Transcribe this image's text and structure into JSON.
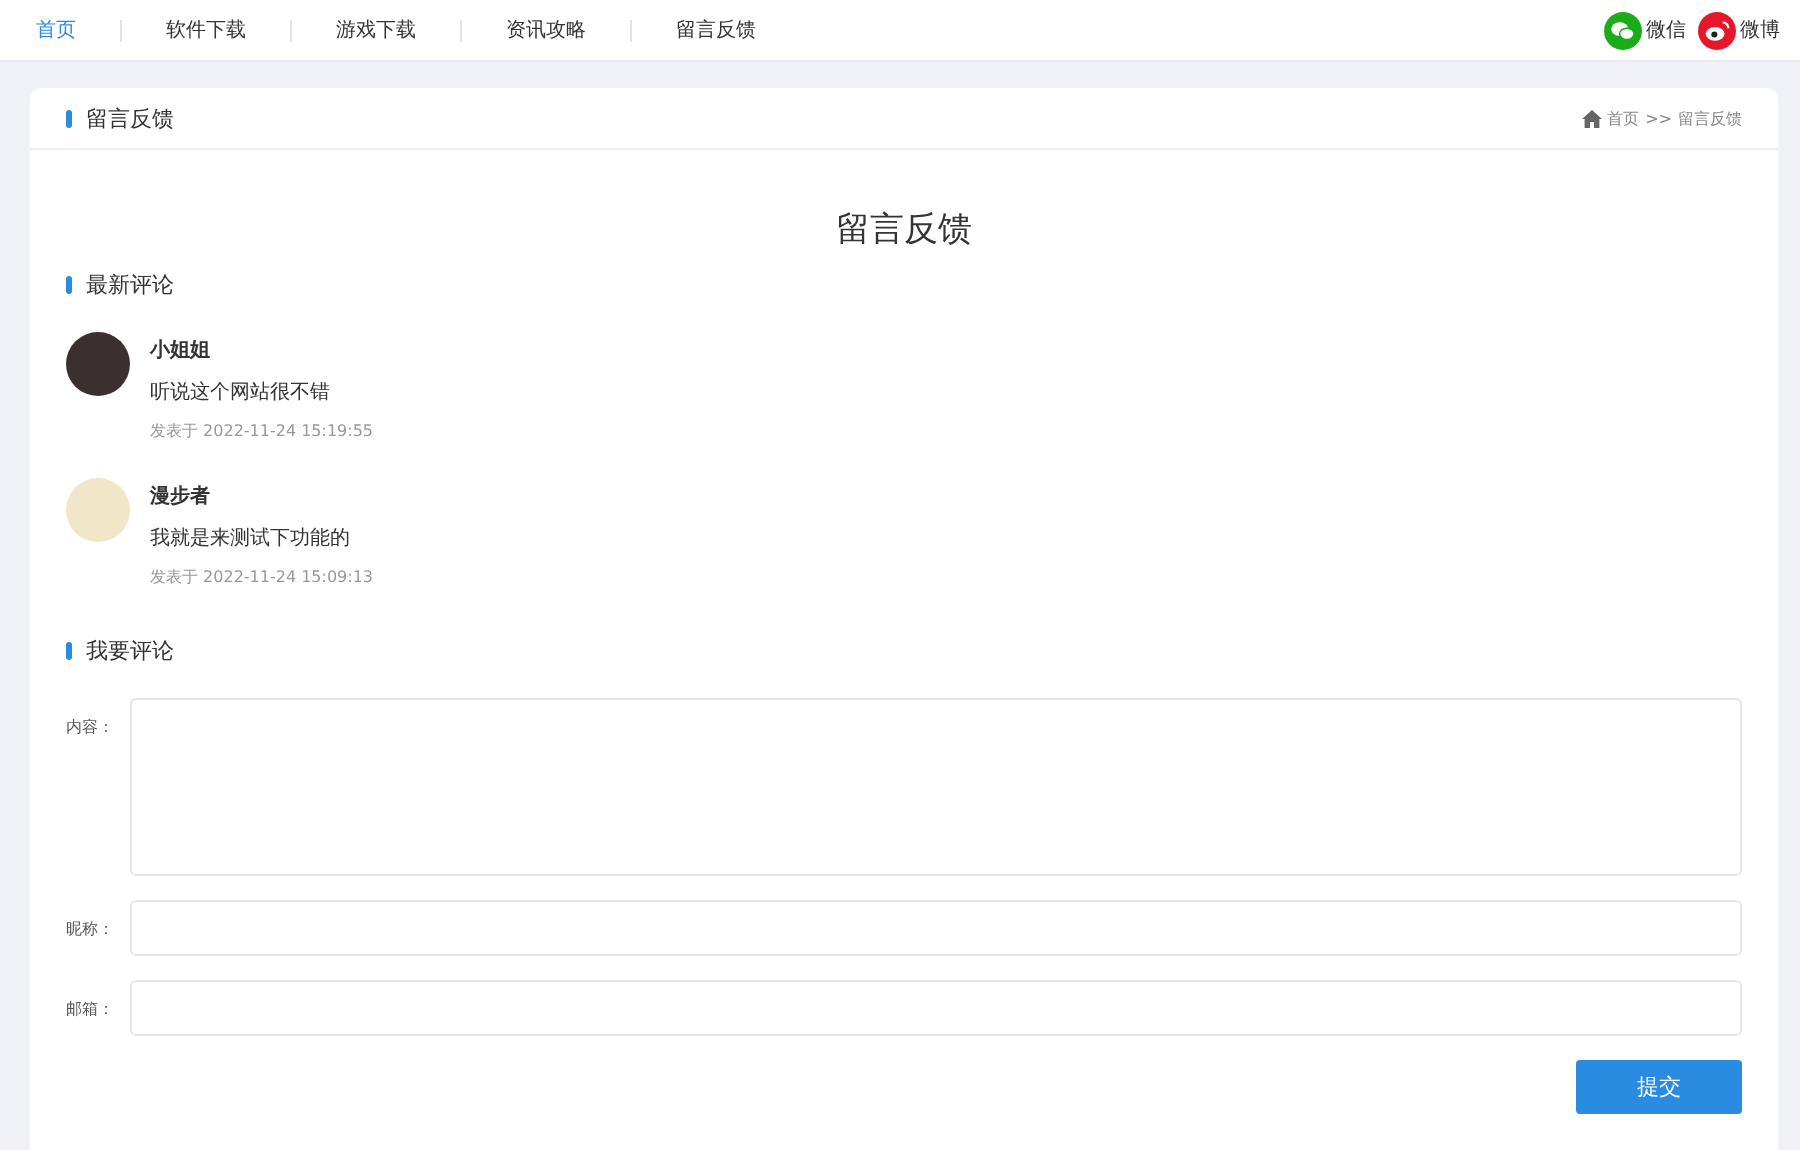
{
  "nav": {
    "items": [
      {
        "label": "首页",
        "selected": true
      },
      {
        "label": "软件下载",
        "selected": false
      },
      {
        "label": "游戏下载",
        "selected": false
      },
      {
        "label": "资讯攻略",
        "selected": false
      },
      {
        "label": "留言反馈",
        "selected": false
      }
    ],
    "social": [
      {
        "kind": "wechat",
        "label": "微信"
      },
      {
        "kind": "weibo",
        "label": "微博"
      }
    ]
  },
  "panel": {
    "title": "留言反馈",
    "breadcrumb": {
      "home": "首页",
      "separator": ">>",
      "current": "留言反馈"
    }
  },
  "heading": "留言反馈",
  "comments_section": {
    "title": "最新评论",
    "comments": [
      {
        "author": "小姐姐",
        "text": "听说这个网站很不错",
        "time": "发表于 2022-11-24 15:19:55"
      },
      {
        "author": "漫步者",
        "text": "我就是来测试下功能的",
        "time": "发表于 2022-11-24 15:09:13"
      }
    ]
  },
  "form_section": {
    "title": "我要评论",
    "fields": [
      {
        "kind": "textarea",
        "label": "内容："
      },
      {
        "kind": "input",
        "label": "昵称："
      },
      {
        "kind": "input",
        "label": "邮箱："
      }
    ],
    "submit": "提交"
  }
}
